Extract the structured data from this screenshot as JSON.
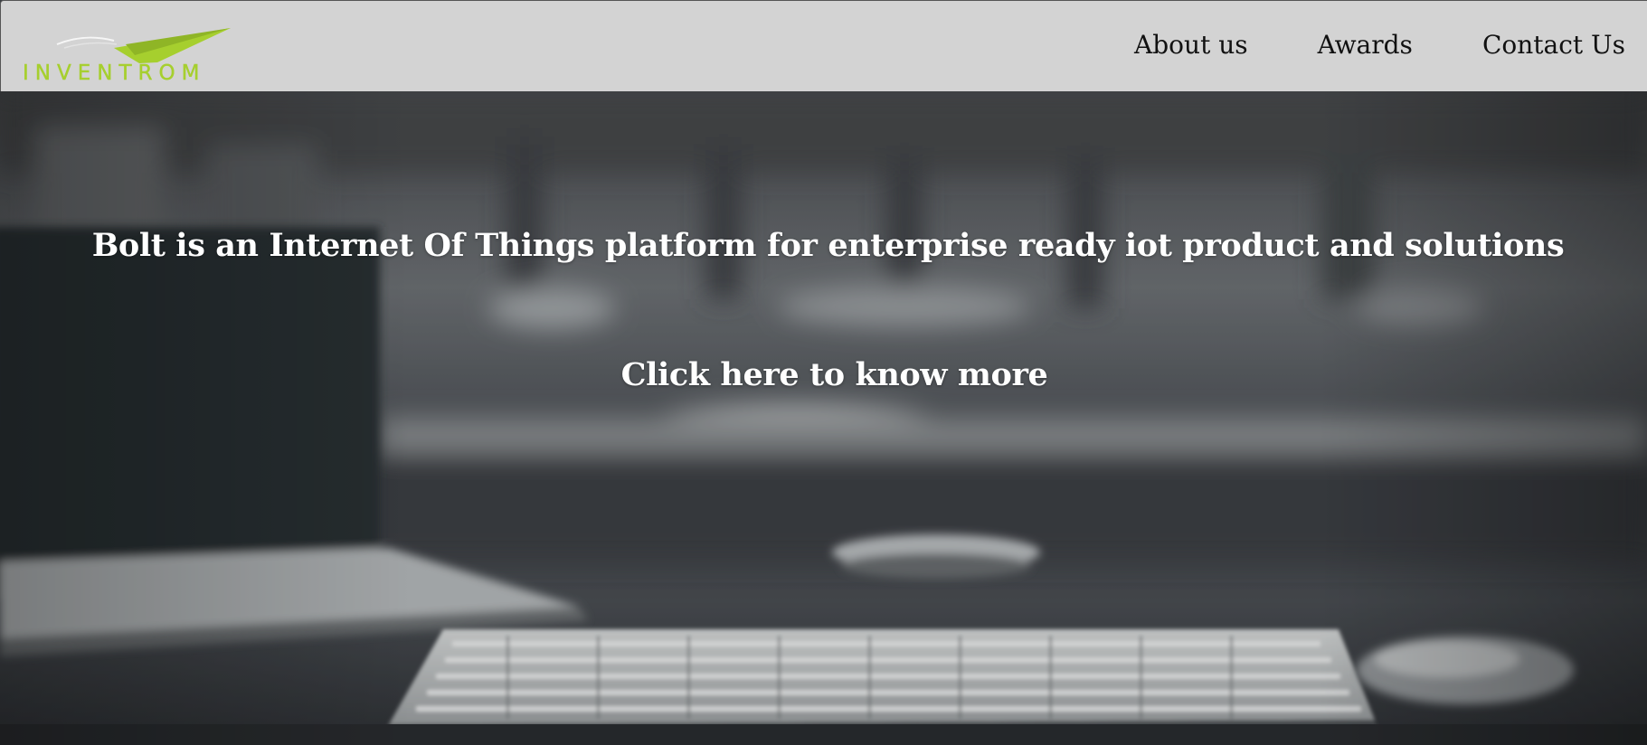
{
  "header": {
    "logo_text": "INVENTROM",
    "nav": [
      {
        "label": "About us"
      },
      {
        "label": "Awards"
      },
      {
        "label": "Contact Us"
      }
    ]
  },
  "hero": {
    "headline": "Bolt is an Internet Of Things platform for enterprise ready iot product and solutions",
    "cta": "Click here to know more",
    "background_image": "blurred desk with laptop, keyboard and mouse"
  },
  "colors": {
    "header_bg": "#d3d3d3",
    "logo_green": "#a6cf2e",
    "nav_text": "#111111",
    "hero_text": "#ffffff"
  }
}
